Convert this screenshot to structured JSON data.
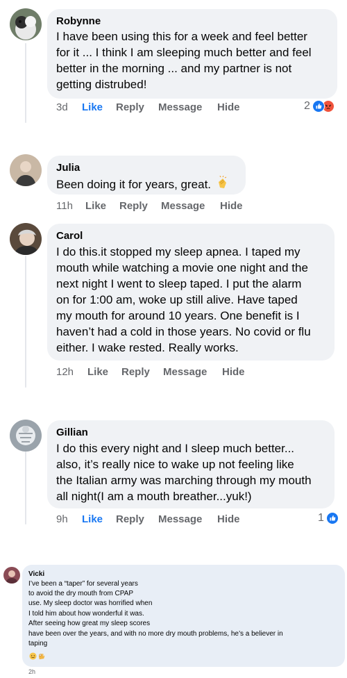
{
  "comments": [
    {
      "name": "Robynne",
      "lines": [
        "I have been using this for a week and feel better",
        "for it ... I think I am sleeping much better and feel",
        "better in the morning ... and my partner is not",
        "getting distrubed!"
      ],
      "time": "3d",
      "like_label": "Like",
      "reply_label": "Reply",
      "message_label": "Message",
      "hide_label": "Hide",
      "liked": true,
      "reaction_count": "2",
      "reactions": [
        "like-icon",
        "angry-icon"
      ]
    },
    {
      "name": "Julia",
      "lines": [
        "Been doing it for years, great."
      ],
      "emoji": "clapping-hands-icon",
      "time": "11h",
      "like_label": "Like",
      "reply_label": "Reply",
      "message_label": "Message",
      "hide_label": "Hide",
      "liked": false
    },
    {
      "name": "Carol",
      "lines": [
        "I do this.it stopped my sleep apnea. I taped my",
        "mouth while watching a movie one night and the",
        "next night I went to sleep taped. I put the alarm",
        "on for 1:00 am, woke up still alive. Have taped",
        "my mouth for around 10 years. One benefit is I",
        "haven’t had a cold in those years. No covid or flu",
        "either. I wake rested. Really works."
      ],
      "time": "12h",
      "like_label": "Like",
      "reply_label": "Reply",
      "message_label": "Message",
      "hide_label": "Hide",
      "liked": false
    },
    {
      "name": "Gillian",
      "lines": [
        "I do this every night and I sleep much better...",
        "also, it’s really nice to wake up not feeling like",
        "the Italian army was marching through my mouth",
        "all night(I am a mouth breather...yuk!)"
      ],
      "time": "9h",
      "like_label": "Like",
      "reply_label": "Reply",
      "message_label": "Message",
      "hide_label": "Hide",
      "liked": true,
      "reaction_count": "1",
      "reactions": [
        "like-icon"
      ]
    }
  ],
  "vicki": {
    "name": "Vicki",
    "lines": [
      "I’ve been a “taper” for several years",
      "to avoid the dry mouth from CPAP",
      "use. My sleep doctor was horrified when",
      "I told him about how wonderful it was.",
      "After seeing how great my sleep scores",
      "have been over the years, and with no more dry mouth problems, he’s a believer in",
      "taping"
    ],
    "emojis": [
      "smiling-face-icon",
      "ok-hand-icon"
    ],
    "time": "2h"
  },
  "colors": {
    "bubble": "#f0f2f5",
    "link_blue": "#1877f2",
    "meta_gray": "#65676b",
    "angry": "#f0533c"
  }
}
